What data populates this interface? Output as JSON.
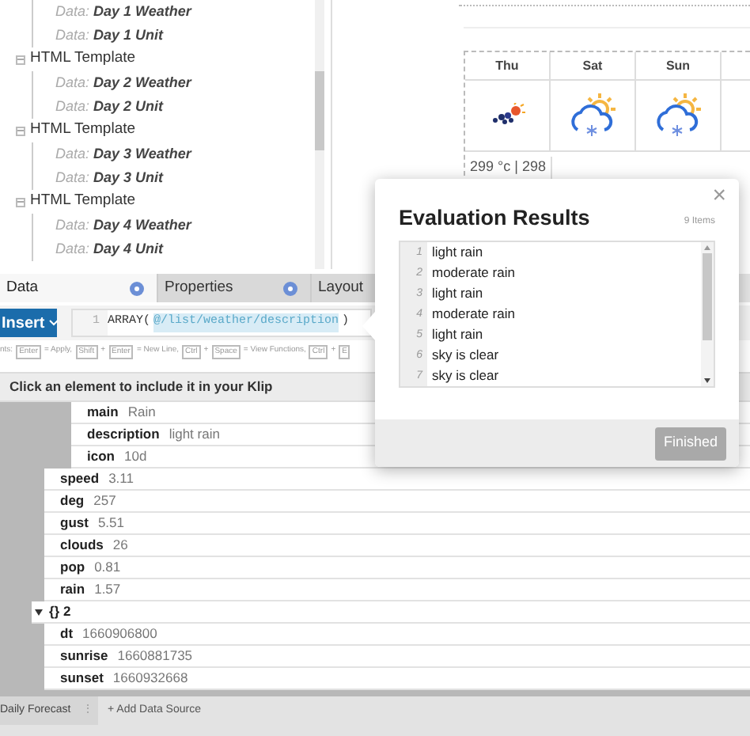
{
  "component_tree": [
    {
      "children": [
        {
          "prefix": "Data:",
          "name": "Day 1 Weather"
        },
        {
          "prefix": "Data:",
          "name": "Day 1 Unit"
        }
      ]
    },
    {
      "label": "HTML Template",
      "expanded": true,
      "children": [
        {
          "prefix": "Data:",
          "name": "Day 2 Weather"
        },
        {
          "prefix": "Data:",
          "name": "Day 2 Unit"
        }
      ]
    },
    {
      "label": "HTML Template",
      "expanded": true,
      "children": [
        {
          "prefix": "Data:",
          "name": "Day 3 Weather"
        },
        {
          "prefix": "Data:",
          "name": "Day 3 Unit"
        }
      ]
    },
    {
      "label": "HTML Template",
      "expanded": true,
      "children": [
        {
          "prefix": "Data:",
          "name": "Day 4 Weather"
        },
        {
          "prefix": "Data:",
          "name": "Day 4 Unit"
        }
      ]
    }
  ],
  "preview": {
    "days": [
      {
        "label": "Thu",
        "kind": "scattered"
      },
      {
        "label": "Sat",
        "kind": "snow"
      },
      {
        "label": "Sun",
        "kind": "snow"
      }
    ],
    "temperature": "299 °c | 298"
  },
  "tabs": [
    {
      "label": "Data",
      "help": true,
      "selected": true
    },
    {
      "label": "Properties",
      "help": true,
      "selected": false
    },
    {
      "label": "Layout",
      "help": false,
      "selected": false
    }
  ],
  "insert_button": "Insert",
  "editor": {
    "line": "1",
    "parts": [
      {
        "kind": "plain",
        "text": "ARRAY("
      },
      {
        "kind": "reference",
        "text": "@/list/weather/description"
      },
      {
        "kind": "plain",
        "text": ")"
      }
    ]
  },
  "hints": [
    {
      "kind": "text",
      "text": "nts:"
    },
    {
      "kind": "key",
      "text": "Enter"
    },
    {
      "kind": "text",
      "text": "= Apply,"
    },
    {
      "kind": "key",
      "text": "Shift"
    },
    {
      "kind": "text",
      "text": "+"
    },
    {
      "kind": "key",
      "text": "Enter"
    },
    {
      "kind": "text",
      "text": "= New Line,"
    },
    {
      "kind": "key",
      "text": "Ctrl"
    },
    {
      "kind": "text",
      "text": "+"
    },
    {
      "kind": "key",
      "text": "Space"
    },
    {
      "kind": "text",
      "text": "= View Functions,"
    },
    {
      "kind": "key",
      "text": "Ctrl"
    },
    {
      "kind": "text",
      "text": "+"
    },
    {
      "kind": "key",
      "text": "E"
    }
  ],
  "data_header": "Click an element to include it in your Klip",
  "data_tree": [
    {
      "children": [
        {
          "children": [
            {
              "key": "main",
              "value": "Rain"
            },
            {
              "key": "description",
              "value": "light rain"
            },
            {
              "key": "icon",
              "value": "10d"
            }
          ]
        },
        {
          "key": "speed",
          "value": "3.11"
        },
        {
          "key": "deg",
          "value": "257"
        },
        {
          "key": "gust",
          "value": "5.51"
        },
        {
          "key": "clouds",
          "value": "26"
        },
        {
          "key": "pop",
          "value": "0.81"
        },
        {
          "key": "rain",
          "value": "1.57"
        }
      ]
    },
    {
      "label": "{} 2",
      "expanded": true,
      "children": [
        {
          "key": "dt",
          "value": "1660906800"
        },
        {
          "key": "sunrise",
          "value": "1660881735"
        },
        {
          "key": "sunset",
          "value": "1660932668"
        }
      ]
    }
  ],
  "bottom_tabs": {
    "source": "Daily Forecast",
    "menu": "⋮",
    "add": "+ Add Data Source"
  },
  "dialog": {
    "title": "Evaluation Results",
    "count": "9 Items",
    "close": "×",
    "results": [
      {
        "n": "1",
        "text": "light rain"
      },
      {
        "n": "2",
        "text": "moderate rain"
      },
      {
        "n": "3",
        "text": "light rain"
      },
      {
        "n": "4",
        "text": "moderate rain"
      },
      {
        "n": "5",
        "text": "light rain"
      },
      {
        "n": "6",
        "text": "sky is clear"
      },
      {
        "n": "7",
        "text": "sky is clear"
      }
    ],
    "button": {
      "label": "Finished",
      "disabled": true
    }
  }
}
